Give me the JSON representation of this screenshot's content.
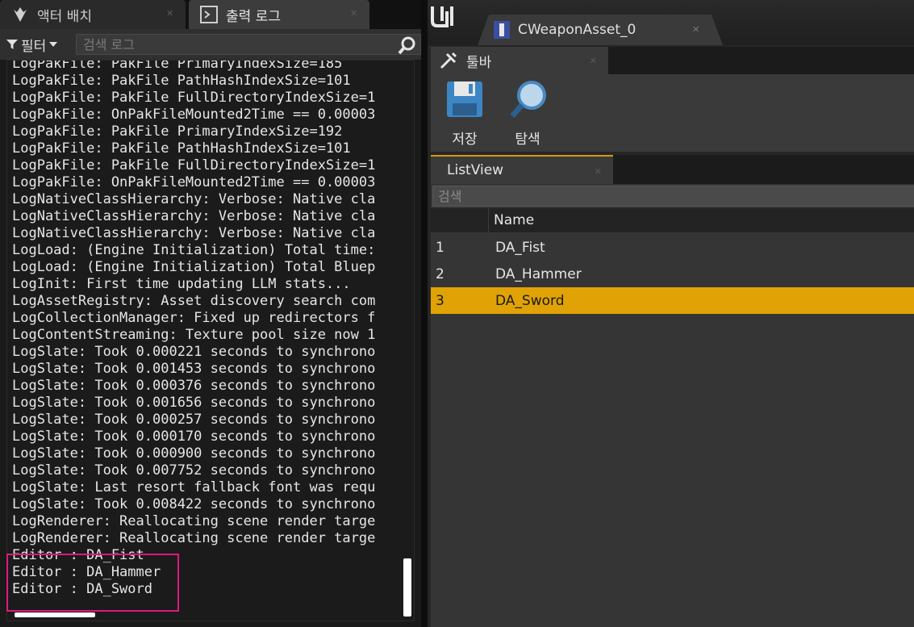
{
  "left_panel": {
    "tabs": [
      {
        "label": "액터 배치",
        "icon": "placement-icon"
      },
      {
        "label": "출력 로그",
        "icon": "output-log-icon"
      }
    ],
    "filter_label": "필터",
    "search_placeholder": "검색 로그",
    "log_lines": [
      "LogPakFile: PakFile PrimaryIndexSize=185",
      "LogPakFile: PakFile PathHashIndexSize=101",
      "LogPakFile: PakFile FullDirectoryIndexSize=1",
      "LogPakFile: OnPakFileMounted2Time == 0.00003",
      "LogPakFile: PakFile PrimaryIndexSize=192",
      "LogPakFile: PakFile PathHashIndexSize=101",
      "LogPakFile: PakFile FullDirectoryIndexSize=1",
      "LogPakFile: OnPakFileMounted2Time == 0.00003",
      "LogNativeClassHierarchy: Verbose: Native cla",
      "LogNativeClassHierarchy: Verbose: Native cla",
      "LogNativeClassHierarchy: Verbose: Native cla",
      "LogLoad: (Engine Initialization) Total time:",
      "LogLoad: (Engine Initialization) Total Bluep",
      "LogInit: First time updating LLM stats...",
      "LogAssetRegistry: Asset discovery search com",
      "LogCollectionManager: Fixed up redirectors f",
      "LogContentStreaming: Texture pool size now 1",
      "LogSlate: Took 0.000221 seconds to synchrono",
      "LogSlate: Took 0.001453 seconds to synchrono",
      "LogSlate: Took 0.000376 seconds to synchrono",
      "LogSlate: Took 0.001656 seconds to synchrono",
      "LogSlate: Took 0.000257 seconds to synchrono",
      "LogSlate: Took 0.000170 seconds to synchrono",
      "LogSlate: Took 0.000900 seconds to synchrono",
      "LogSlate: Took 0.007752 seconds to synchrono",
      "LogSlate: Last resort fallback font was requ",
      "LogSlate: Took 0.008422 seconds to synchrono",
      "LogRenderer: Reallocating scene render targe",
      "LogRenderer: Reallocating scene render targe",
      "Editor : DA_Fist",
      "Editor : DA_Hammer",
      "Editor : DA_Sword"
    ],
    "highlight_color": "#e0197b"
  },
  "right_panel": {
    "asset_tab_label": "CWeaponAsset_0",
    "toolbar_tab_label": "툴바",
    "tools": [
      {
        "label": "저장",
        "icon": "save-icon"
      },
      {
        "label": "탐색",
        "icon": "browse-icon"
      }
    ],
    "listview_tab_label": "ListView",
    "search_placeholder": "검색",
    "column_name": "Name",
    "rows": [
      {
        "index": "1",
        "name": "DA_Fist",
        "selected": false
      },
      {
        "index": "2",
        "name": "DA_Hammer",
        "selected": false
      },
      {
        "index": "3",
        "name": "DA_Sword",
        "selected": true
      }
    ],
    "selection_color": "#e0a205"
  }
}
